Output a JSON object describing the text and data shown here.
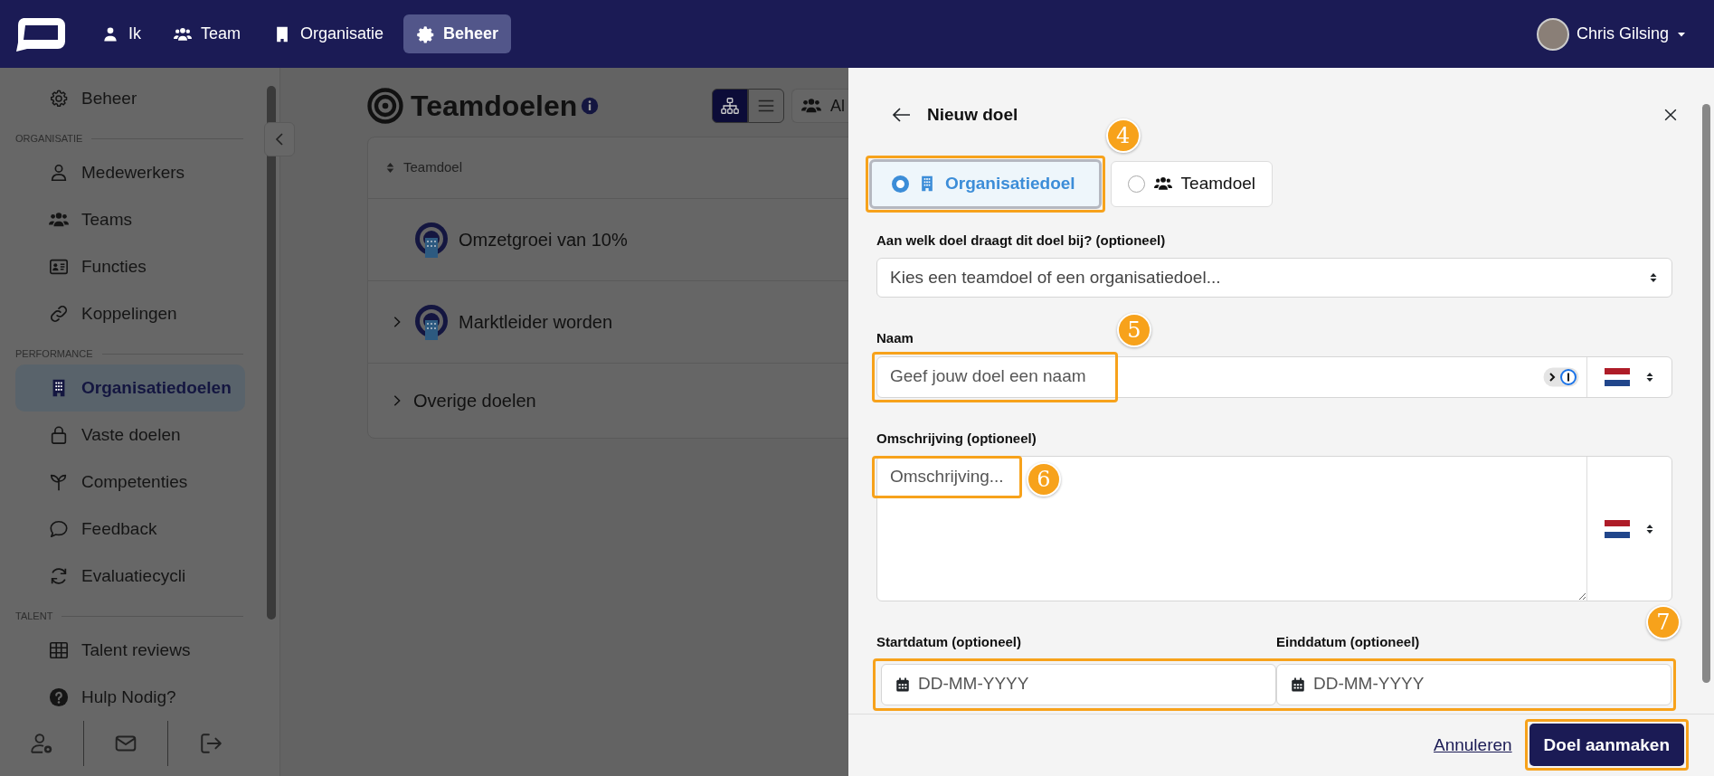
{
  "topbar": {
    "nav": [
      {
        "label": "Ik",
        "selected": false
      },
      {
        "label": "Team",
        "selected": false
      },
      {
        "label": "Organisatie",
        "selected": false
      },
      {
        "label": "Beheer",
        "selected": true
      }
    ],
    "user": {
      "name": "Chris Gilsing"
    }
  },
  "sidebar": {
    "items": [
      {
        "label": "Beheer",
        "selected": false
      }
    ],
    "sections": [
      {
        "heading": "ORGANISATIE",
        "items": [
          {
            "label": "Medewerkers",
            "selected": false
          },
          {
            "label": "Teams",
            "selected": false
          },
          {
            "label": "Functies",
            "selected": false
          },
          {
            "label": "Koppelingen",
            "selected": false
          }
        ]
      },
      {
        "heading": "PERFORMANCE",
        "items": [
          {
            "label": "Organisatiedoelen",
            "selected": true
          },
          {
            "label": "Vaste doelen",
            "selected": false
          },
          {
            "label": "Competenties",
            "selected": false
          },
          {
            "label": "Feedback",
            "selected": false
          },
          {
            "label": "Evaluatiecycli",
            "selected": false
          }
        ]
      },
      {
        "heading": "TALENT",
        "items": [
          {
            "label": "Talent reviews",
            "selected": false
          }
        ]
      }
    ],
    "help": "Hulp Nodig?"
  },
  "main": {
    "title": "Teamdoelen",
    "views": [
      {
        "selected": true
      },
      {
        "selected": false
      }
    ],
    "filter": "Al",
    "column": "Teamdoel",
    "rows": [
      {
        "kind": "goal",
        "label": "Omzetgroei van 10%",
        "expandable": false
      },
      {
        "kind": "goal",
        "label": "Marktleider worden",
        "expandable": true
      },
      {
        "kind": "group",
        "label": "Overige doelen",
        "expandable": true
      }
    ]
  },
  "panel": {
    "title": "Nieuw doel",
    "goal_types_callout": "4",
    "goal_types": [
      {
        "label": "Organisatiedoel",
        "selected": true
      },
      {
        "label": "Teamdoel",
        "selected": false
      }
    ],
    "parent": {
      "label": "Aan welk doel draagt dit doel bij? (optioneel)",
      "placeholder": "Kies een teamdoel of een organisatiedoel..."
    },
    "name": {
      "label": "Naam",
      "placeholder": "Geef jouw doel een naam",
      "callout": "5"
    },
    "description": {
      "label": "Omschrijving (optioneel)",
      "placeholder": "Omschrijving...",
      "callout": "6"
    },
    "dates": {
      "callout": "7",
      "fields": [
        {
          "label": "Startdatum (optioneel)",
          "placeholder": "DD-MM-YYYY"
        },
        {
          "label": "Einddatum (optioneel)",
          "placeholder": "DD-MM-YYYY"
        }
      ]
    },
    "cancel": "Annuleren",
    "submit": {
      "label": "Doel aanmaken",
      "highlighted": true
    }
  }
}
